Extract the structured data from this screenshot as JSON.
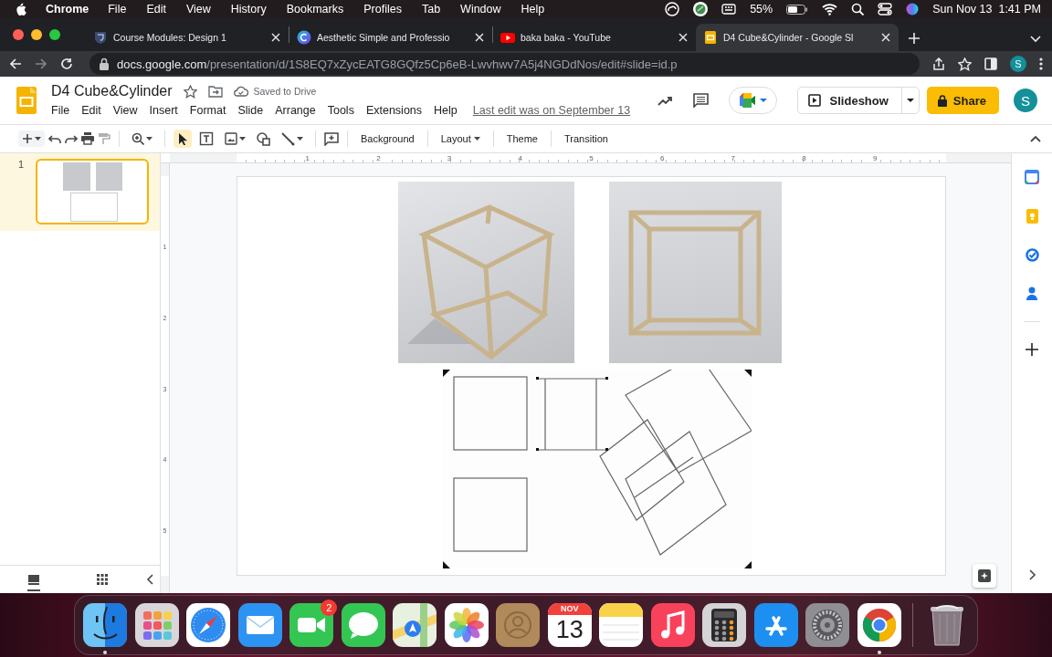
{
  "menubar": {
    "app": "Chrome",
    "menus": [
      "File",
      "Edit",
      "View",
      "History",
      "Bookmarks",
      "Profiles",
      "Tab",
      "Window",
      "Help"
    ],
    "battery_percent": "55%",
    "clock": "Sun Nov 13  1:41 PM"
  },
  "browser": {
    "tabs": [
      {
        "title": "Course Modules: Design 1",
        "kind": "shield",
        "selected": false
      },
      {
        "title": "Aesthetic Simple and Professio",
        "kind": "circle",
        "selected": false
      },
      {
        "title": "baka baka - YouTube",
        "kind": "play",
        "selected": false
      },
      {
        "title": "D4 Cube&Cylinder - Google Sl",
        "kind": "slides",
        "selected": true
      }
    ],
    "url_host": "docs.google.com",
    "url_path": "/presentation/d/1S8EQ7xZycEATG8GQfz5Cp6eB-Lwvhwv7A5j4NGDdNos/edit#slide=id.p",
    "profile_initial": "S"
  },
  "document": {
    "title": "D4 Cube&Cylinder",
    "save_status": "Saved to Drive",
    "menus": [
      "File",
      "Edit",
      "View",
      "Insert",
      "Format",
      "Slide",
      "Arrange",
      "Tools",
      "Extensions",
      "Help"
    ],
    "last_edit": "Last edit was on September 13",
    "slideshow_label": "Slideshow",
    "share_label": "Share",
    "avatar_initial": "S"
  },
  "toolbar": {
    "tools": [
      {
        "kind": "select",
        "selected": true
      },
      {
        "kind": "textbox",
        "selected": false
      },
      {
        "kind": "image",
        "selected": false
      },
      {
        "kind": "shape",
        "selected": false
      },
      {
        "kind": "line",
        "selected": false
      }
    ],
    "text_buttons": [
      {
        "label": "Background",
        "dropdown": false
      },
      {
        "label": "Layout",
        "dropdown": true
      },
      {
        "label": "Theme",
        "dropdown": false
      },
      {
        "label": "Transition",
        "dropdown": false
      }
    ]
  },
  "ruler": {
    "horizontal": [
      "1",
      "2",
      "3",
      "4",
      "5",
      "6",
      "7",
      "8",
      "9"
    ],
    "vertical": [
      "1",
      "2",
      "3",
      "4",
      "5"
    ]
  },
  "filmstrip": {
    "slides": [
      {
        "number": "1",
        "selected": true
      }
    ]
  },
  "slide": {
    "images": [
      {
        "kind": "photo",
        "selected": false
      },
      {
        "kind": "photo",
        "selected": false
      },
      {
        "kind": "drawing",
        "selected": true
      }
    ]
  },
  "dock": {
    "apps": [
      {
        "kind": "finder",
        "running": true
      },
      {
        "kind": "launchpad",
        "running": false
      },
      {
        "kind": "safari",
        "running": false
      },
      {
        "kind": "mail",
        "running": false
      },
      {
        "kind": "facetime",
        "running": false,
        "badge": "2"
      },
      {
        "kind": "messages",
        "running": false
      },
      {
        "kind": "maps",
        "running": false
      },
      {
        "kind": "photos",
        "running": false
      },
      {
        "kind": "contacts",
        "running": false
      },
      {
        "kind": "calendar",
        "running": false,
        "month": "NOV",
        "day": "13"
      },
      {
        "kind": "notes",
        "running": false
      },
      {
        "kind": "music",
        "running": false
      },
      {
        "kind": "calculator",
        "running": false
      },
      {
        "kind": "appstore",
        "running": false
      },
      {
        "kind": "settings",
        "running": false
      },
      {
        "kind": "chrome",
        "running": true
      }
    ]
  }
}
